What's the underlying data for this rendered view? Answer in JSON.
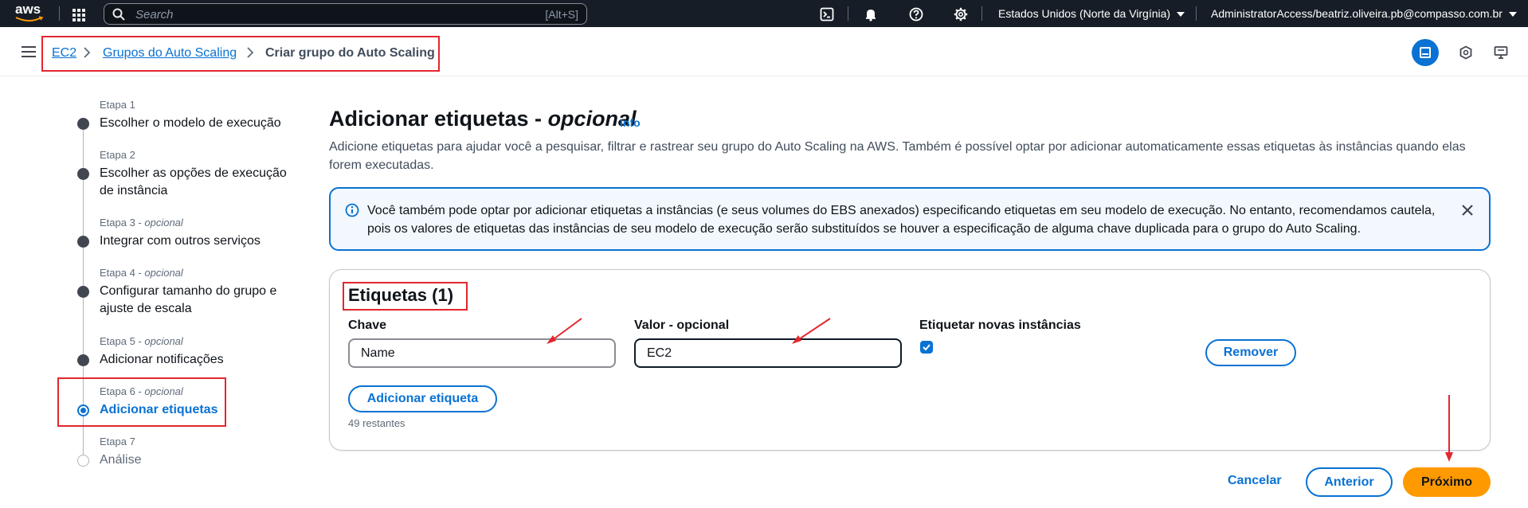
{
  "topbar": {
    "logo_text": "aws",
    "search_placeholder": "Search",
    "search_shortcut": "[Alt+S]",
    "region": "Estados Unidos (Norte da Virgínia)",
    "account": "AdministratorAccess/beatriz.oliveira.pb@compasso.com.br"
  },
  "breadcrumb": {
    "items": [
      "EC2",
      "Grupos do Auto Scaling",
      "Criar grupo do Auto Scaling"
    ]
  },
  "steps": [
    {
      "label": "Etapa 1",
      "optional": "",
      "title": "Escolher o modelo de execução"
    },
    {
      "label": "Etapa 2",
      "optional": "",
      "title": "Escolher as opções de execução de instância"
    },
    {
      "label": "Etapa 3 - ",
      "optional": "opcional",
      "title": "Integrar com outros serviços"
    },
    {
      "label": "Etapa 4 - ",
      "optional": "opcional",
      "title": "Configurar tamanho do grupo e ajuste de escala"
    },
    {
      "label": "Etapa 5 - ",
      "optional": "opcional",
      "title": "Adicionar notificações"
    },
    {
      "label": "Etapa 6 - ",
      "optional": "opcional",
      "title": "Adicionar etiquetas"
    },
    {
      "label": "Etapa 7",
      "optional": "",
      "title": "Análise"
    }
  ],
  "main": {
    "heading": "Adicionar etiquetas - ",
    "heading_optional": "opcional",
    "info": "Info",
    "description": "Adicione etiquetas para ajudar você a pesquisar, filtrar e rastrear seu grupo do Auto Scaling na AWS. Também é possível optar por adicionar automaticamente essas etiquetas às instâncias quando elas forem executadas.",
    "alert": "Você também pode optar por adicionar etiquetas a instâncias (e seus volumes do EBS anexados) especificando etiquetas em seu modelo de execução. No entanto, recomendamos cautela, pois os valores de etiquetas das instâncias de seu modelo de execução serão substituídos se houver a especificação de alguma chave duplicada para o grupo do Auto Scaling."
  },
  "tags_panel": {
    "title": "Etiquetas (1)",
    "key_label": "Chave",
    "value_label": "Valor - opcional",
    "propagate_label": "Etiquetar novas instâncias",
    "key_value": "Name",
    "value_value": "EC2",
    "propagate_checked": true,
    "remove_button": "Remover",
    "add_button": "Adicionar etiqueta",
    "remaining": "49 restantes"
  },
  "footer": {
    "cancel": "Cancelar",
    "previous": "Anterior",
    "next": "Próximo"
  },
  "colors": {
    "accent": "#0972d3",
    "primary_button": "#ff9900",
    "annotation": "#e3262f",
    "topbar": "#161d26"
  }
}
